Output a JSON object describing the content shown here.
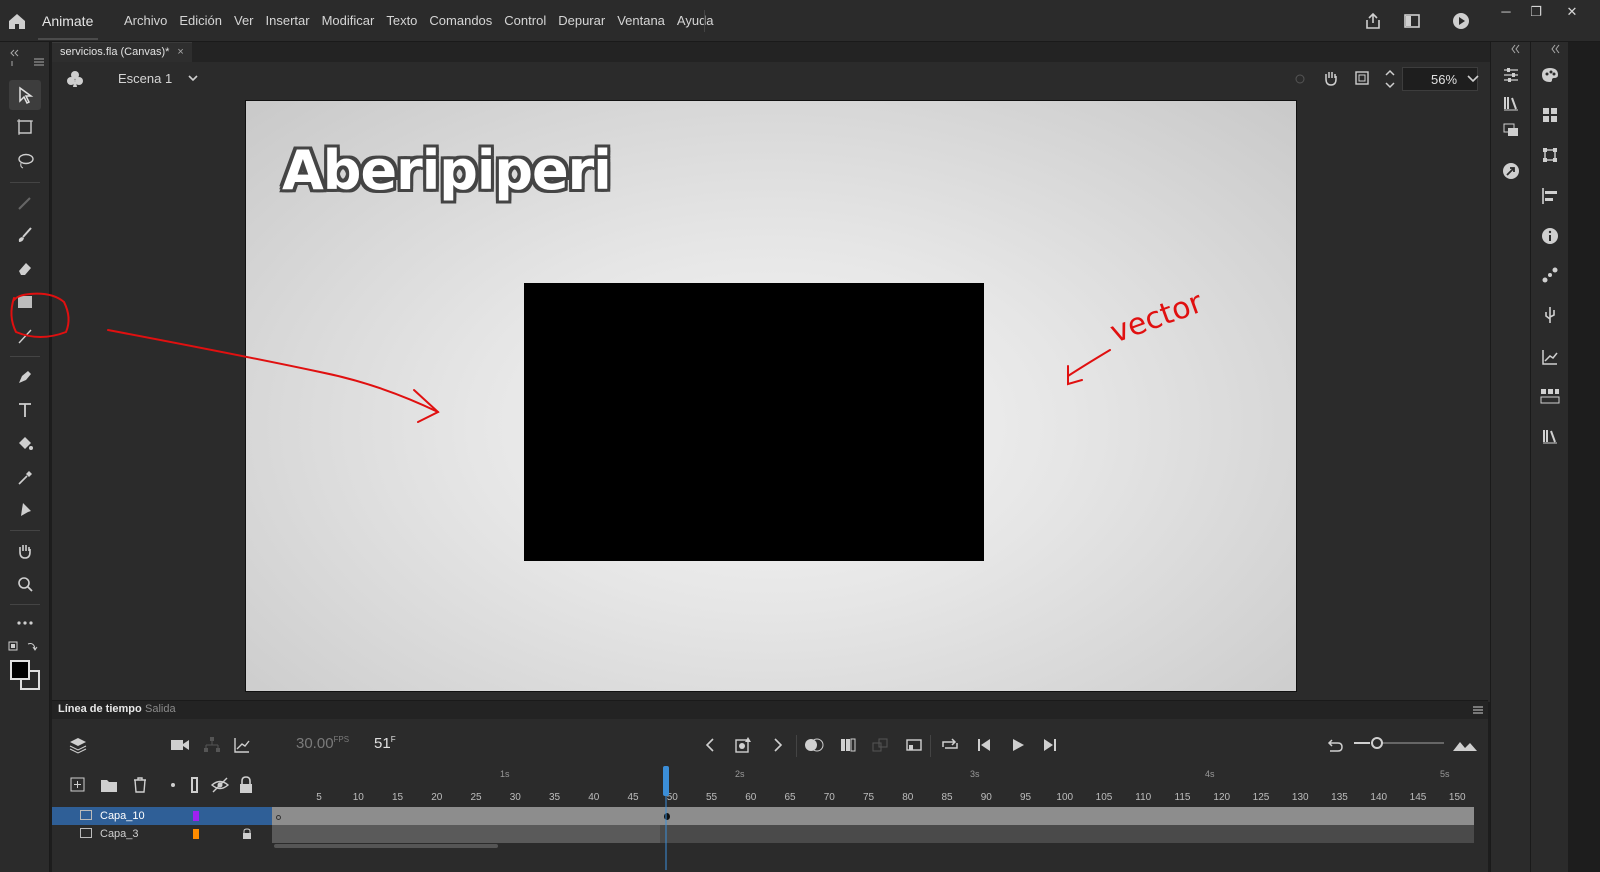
{
  "app": {
    "name": "Animate",
    "menus": [
      "Archivo",
      "Edición",
      "Ver",
      "Insertar",
      "Modificar",
      "Texto",
      "Comandos",
      "Control",
      "Depurar",
      "Ventana",
      "Ayuda"
    ],
    "window_buttons": [
      "─",
      "❐",
      "✕"
    ]
  },
  "document": {
    "tab_label": "servicios.fla (Canvas)*",
    "tab_close": "×"
  },
  "scene": {
    "label": "Escena 1",
    "zoom": "56%"
  },
  "stage": {
    "logo_text": "Aberipiperi",
    "handwritten_note": "vector",
    "rect_color": "#000000"
  },
  "timeline": {
    "tab_active": "Línea de tiempo",
    "tab_inactive": "Salida",
    "fps": "30.00",
    "fps_unit": "FPS",
    "frame": "51",
    "frame_unit": "F",
    "ruler_ticks": [
      "5",
      "10",
      "15",
      "20",
      "25",
      "30",
      "35",
      "40",
      "45",
      "50",
      "55",
      "60",
      "65",
      "70",
      "75",
      "80",
      "85",
      "90",
      "95",
      "100",
      "105",
      "110",
      "115",
      "120",
      "125",
      "130",
      "135",
      "140",
      "145",
      "150"
    ],
    "ruler_seconds": [
      "1s",
      "2s",
      "3s",
      "4s",
      "5s"
    ],
    "layers": [
      {
        "name": "Capa_10",
        "color": "#a020f0",
        "selected": true
      },
      {
        "name": "Capa_3",
        "color": "#ff8c00",
        "selected": false
      }
    ]
  },
  "colors": {
    "accent": "#2f5f97",
    "annotation": "#e01010",
    "playhead": "#3b8ed8"
  }
}
